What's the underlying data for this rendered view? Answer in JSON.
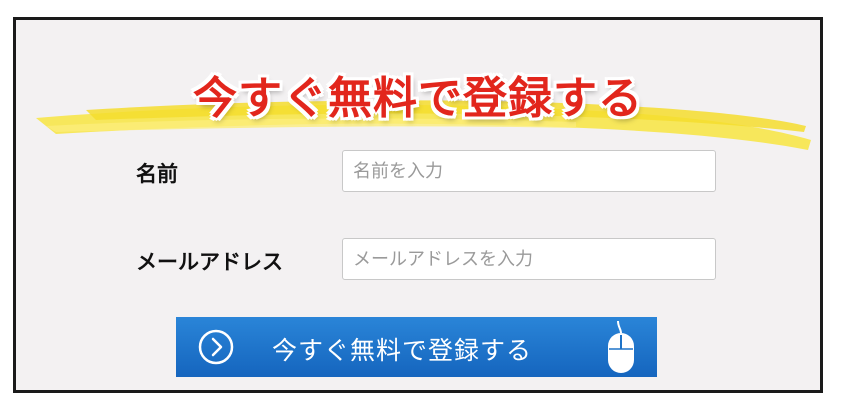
{
  "hero": {
    "title": "今すぐ無料で登録する"
  },
  "form": {
    "name": {
      "label": "名前",
      "placeholder": "名前を入力",
      "value": ""
    },
    "email": {
      "label": "メールアドレス",
      "placeholder": "メールアドレスを入力",
      "value": ""
    }
  },
  "cta": {
    "label": "今すぐ無料で登録する",
    "arrow_icon": "chevron-right-circle-icon",
    "mouse_icon": "mouse-icon"
  },
  "colors": {
    "title_red": "#e2261c",
    "brush_yellow": "#f7e54a",
    "button_blue": "#1e73c8",
    "panel_bg": "#f3f1f2",
    "border": "#1a1a1a"
  }
}
